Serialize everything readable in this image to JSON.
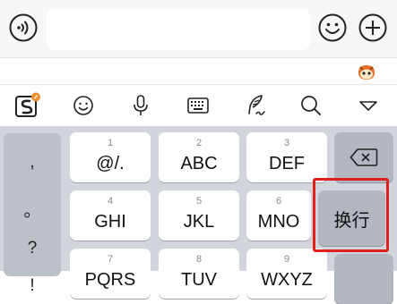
{
  "chat_bar": {
    "icons": {
      "voice": "voice-mode-icon",
      "emoji": "emoji-icon",
      "plus": "plus-icon"
    },
    "input_value": ""
  },
  "suggest_strip": {
    "mascot_icon": "sogou-mascot-icon"
  },
  "toolbar": {
    "items": [
      {
        "name": "sogou-logo-icon"
      },
      {
        "name": "emoji-icon"
      },
      {
        "name": "microphone-icon"
      },
      {
        "name": "keyboard-icon"
      },
      {
        "name": "handwriting-icon"
      },
      {
        "name": "search-icon"
      },
      {
        "name": "collapse-keyboard-icon"
      }
    ]
  },
  "keyboard": {
    "symbols": [
      ",",
      "。",
      "?",
      "!"
    ],
    "keys": [
      {
        "hint": "1",
        "label": "@/."
      },
      {
        "hint": "2",
        "label": "ABC"
      },
      {
        "hint": "3",
        "label": "DEF"
      },
      {
        "hint": "4",
        "label": "GHI"
      },
      {
        "hint": "5",
        "label": "JKL"
      },
      {
        "hint": "6",
        "label": "MNO"
      },
      {
        "hint": "7",
        "label": "PQRS"
      },
      {
        "hint": "8",
        "label": "TUV"
      },
      {
        "hint": "9",
        "label": "WXYZ"
      }
    ],
    "delete_icon": "backspace-icon",
    "enter_label": "换行",
    "highlight_color": "#e0201b"
  }
}
